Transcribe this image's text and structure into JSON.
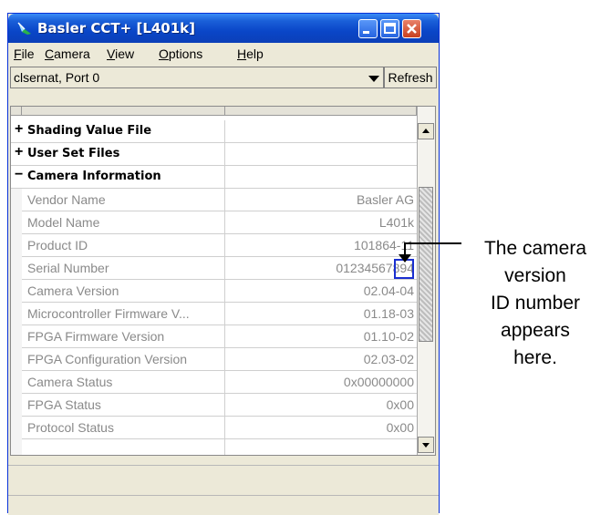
{
  "window": {
    "title": "Basler CCT+ [L401k]",
    "menu": [
      "File",
      "Camera",
      "View",
      "Options",
      "Help"
    ],
    "port": "clsernat, Port 0",
    "refresh_label": "Refresh"
  },
  "grid": {
    "groups": [
      {
        "label": "Shading Value File",
        "expander": "+"
      },
      {
        "label": "User Set Files",
        "expander": "+"
      },
      {
        "label": "Camera Information",
        "expander": "−"
      }
    ],
    "rows": [
      {
        "name": "Vendor Name",
        "value": "Basler AG"
      },
      {
        "name": "Model Name",
        "value": "L401k"
      },
      {
        "name": "Product ID",
        "value": "101864-11"
      },
      {
        "name": "Serial Number",
        "value": "01234567894"
      },
      {
        "name": "Camera Version",
        "value": "02.04-04"
      },
      {
        "name": "Microcontroller Firmware V...",
        "value": "01.18-03"
      },
      {
        "name": "FPGA Firmware Version",
        "value": "01.10-02"
      },
      {
        "name": "FPGA Configuration Version",
        "value": "02.03-02"
      },
      {
        "name": "Camera Status",
        "value": "0x00000000"
      },
      {
        "name": "FPGA Status",
        "value": "0x00"
      },
      {
        "name": "Protocol Status",
        "value": "0x00"
      }
    ]
  },
  "callout": {
    "lines": [
      "The camera",
      "version",
      "ID number",
      "appears",
      "here."
    ]
  }
}
